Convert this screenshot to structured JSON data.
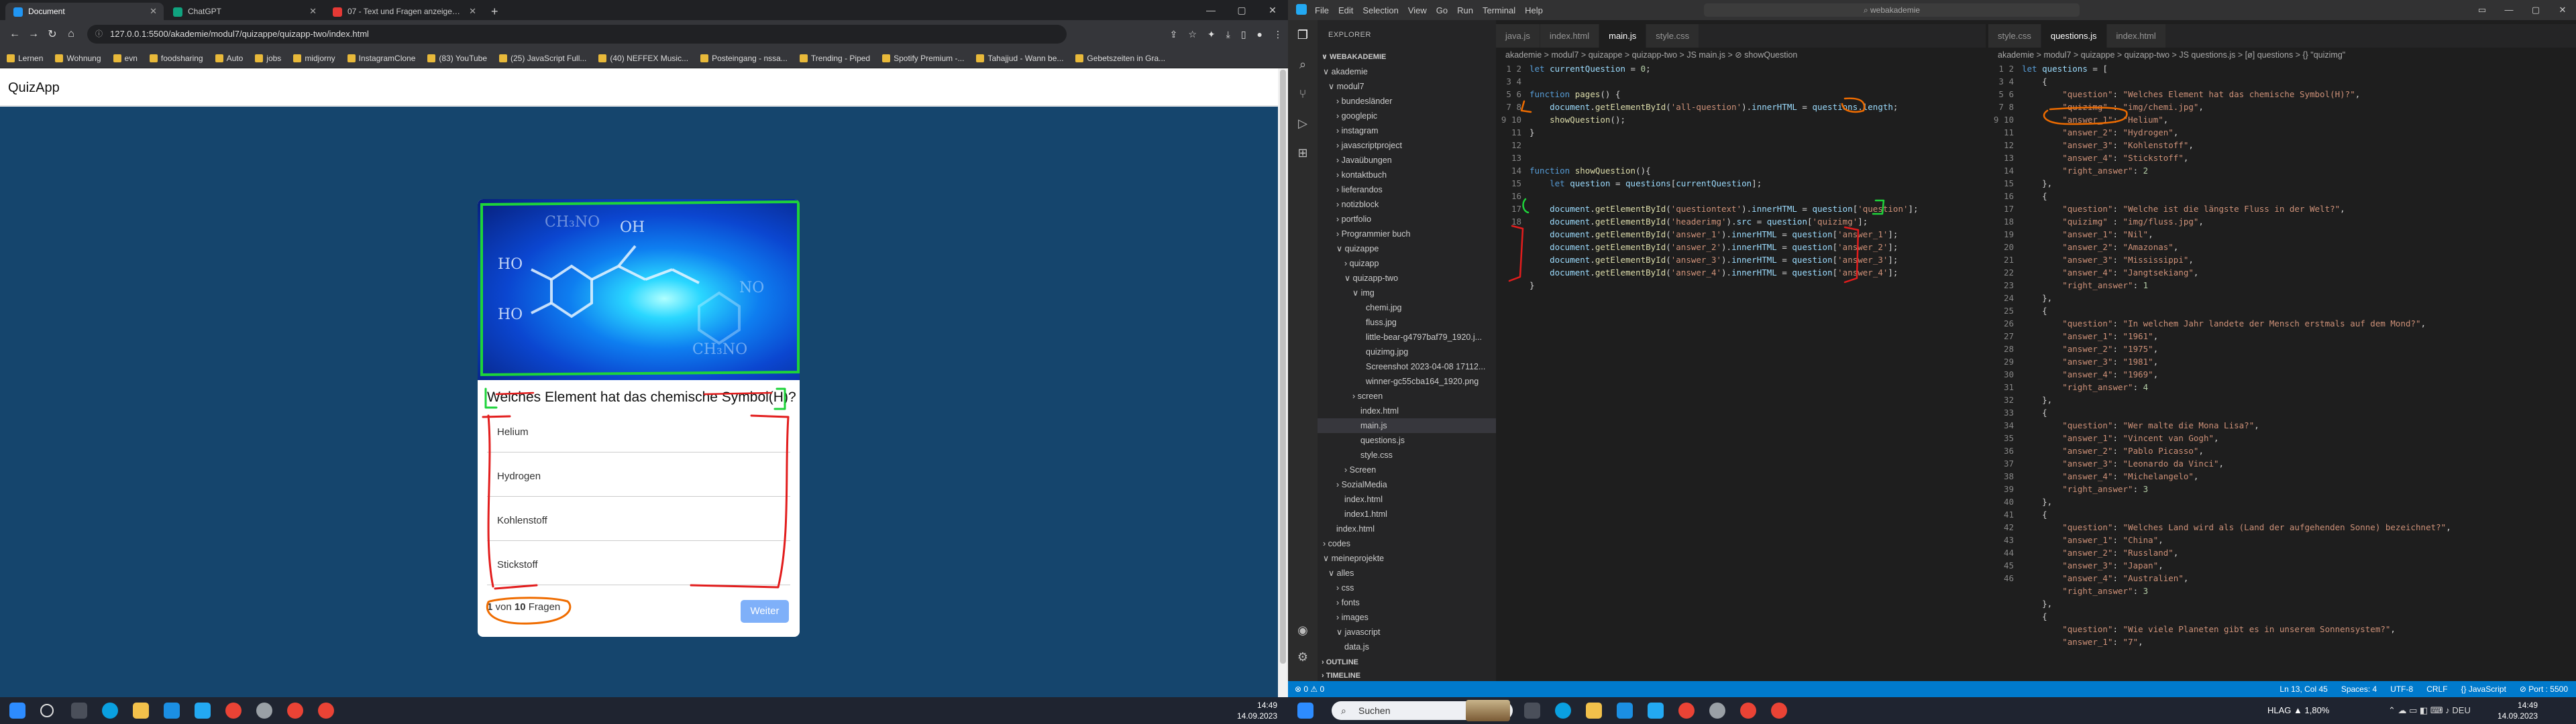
{
  "browser": {
    "tabs": [
      {
        "title": "Document",
        "active": true,
        "icon_color": "#2196f3"
      },
      {
        "title": "ChatGPT",
        "active": false,
        "icon_color": "#10a37f"
      },
      {
        "title": "07 - Text und Fragen anzeigen | D",
        "active": false,
        "icon_color": "#e53935"
      }
    ],
    "url": "127.0.0.1:5500/akademie/modul7/quizappe/quizapp-two/index.html",
    "bookmarks": [
      "Lernen",
      "Wohnung",
      "evn",
      "foodsharing",
      "Auto",
      "jobs",
      "midjorny",
      "InstagramClone",
      "(83) YouTube",
      "(25) JavaScript Full...",
      "(40) NEFFEX Music...",
      "Posteingang - nssa...",
      "Trending - Piped",
      "Spotify Premium -...",
      "Tahajjud - Wann be...",
      "Gebetszeiten in Gra..."
    ]
  },
  "quiz": {
    "brand": "QuizApp",
    "question": "Welches Element hat das chemische Symbol(H)?",
    "answers": [
      "Helium",
      "Hydrogen",
      "Kohlenstoff",
      "Stickstoff"
    ],
    "counter_current": "1",
    "counter_von": "von",
    "counter_total": "10",
    "counter_suffix": "Fragen",
    "next_label": "Weiter",
    "image_labels": [
      "HO",
      "HO",
      "OH",
      "CH₃NO",
      "CH₃NO",
      "NO"
    ]
  },
  "taskbar": {
    "time": "14:49",
    "date": "14.09.2023",
    "search_placeholder": "Suchen",
    "weather": "HLAG ▲ 1,80%",
    "lang": "DEU"
  },
  "vscode": {
    "menu": [
      "File",
      "Edit",
      "Selection",
      "View",
      "Go",
      "Run",
      "Terminal",
      "Help"
    ],
    "search_text": "webakademie",
    "explorer_title": "EXPLORER",
    "workspace": "WEBAKADEMIE",
    "tree": [
      "∨ akademie",
      "∨ modul7",
      "› bundesländer",
      "› googlepic",
      "› instagram",
      "› javascriptproject",
      "› Javaübungen",
      "› kontaktbuch",
      "› lieferandos",
      "› notizblock",
      "› portfolio",
      "› Programmier buch",
      "∨ quizappe",
      "› quizapp",
      "∨ quizapp-two",
      "∨ img",
      "chemi.jpg",
      "fluss.jpg",
      "little-bear-g4797baf79_1920.j...",
      "quizimg.jpg",
      "Screenshot 2023-04-08 17112...",
      "winner-gc55cba164_1920.png",
      "› screen",
      "index.html",
      "main.js",
      "questions.js",
      "style.css",
      "› Screen",
      "› SozialMedia",
      "index.html",
      "index1.html",
      "index.html",
      "› codes",
      "∨ meineprojekte",
      "∨ alles",
      "› css",
      "› fonts",
      "› images",
      "∨ javascript",
      "data.js"
    ],
    "outline": "OUTLINE",
    "timeline": "TIMELINE",
    "tabs_left": [
      "java.js",
      "index.html",
      "main.js",
      "style.css"
    ],
    "tabs_right": [
      "style.css",
      "questions.js",
      "index.html"
    ],
    "breadcrumb_left": "akademie > modul7 > quizappe > quizapp-two > JS main.js > ⊘ showQuestion",
    "breadcrumb_right": "akademie > modul7 > quizappe > quizapp-two > JS questions.js > [ø] questions > {} \"quizimg\"",
    "status_left": "⊗ 0 ⚠ 0",
    "status_right": [
      "Ln 13, Col 45",
      "Spaces: 4",
      "UTF-8",
      "CRLF",
      "{} JavaScript",
      "⊘ Port : 5500"
    ]
  }
}
